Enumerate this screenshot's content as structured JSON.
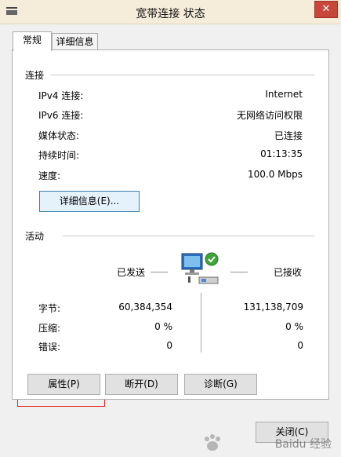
{
  "window": {
    "title": "宽带连接 状态",
    "close_glyph": "✕"
  },
  "tabs": [
    {
      "label": "常规",
      "active": true
    },
    {
      "label": "详细信息",
      "active": false
    }
  ],
  "connection": {
    "section_title": "连接",
    "rows": [
      {
        "label": "IPv4 连接:",
        "value": "Internet"
      },
      {
        "label": "IPv6 连接:",
        "value": "无网络访问权限"
      },
      {
        "label": "媒体状态:",
        "value": "已连接"
      },
      {
        "label": "持续时间:",
        "value": "01:13:35"
      },
      {
        "label": "速度:",
        "value": "100.0 Mbps"
      }
    ],
    "details_button": "详细信息(E)..."
  },
  "activity": {
    "section_title": "活动",
    "sent_label": "已发送",
    "received_label": "已接收",
    "rows": [
      {
        "label": "字节:",
        "sent": "60,384,354",
        "received": "131,138,709"
      },
      {
        "label": "压缩:",
        "sent": "0 %",
        "received": "0 %"
      },
      {
        "label": "错误:",
        "sent": "0",
        "received": "0"
      }
    ],
    "network_icon": "network-connected-icon"
  },
  "buttons": {
    "properties": "属性(P)",
    "disable": "断开(D)",
    "diagnose": "诊断(G)",
    "close": "关闭(C)"
  },
  "annotations": {
    "highlight_color": "#e0271c"
  },
  "watermark": {
    "text": "Baidu 经验"
  }
}
